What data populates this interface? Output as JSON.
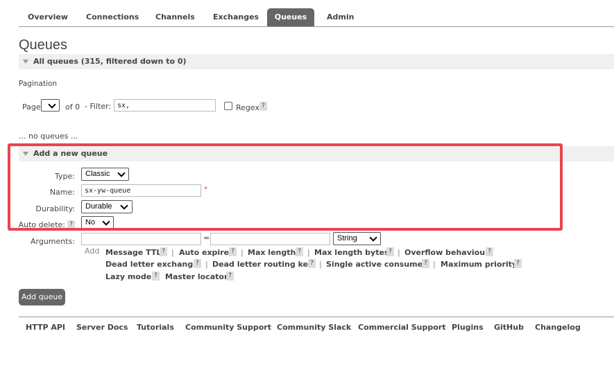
{
  "tabs": [
    {
      "label": "Overview",
      "active": false
    },
    {
      "label": "Connections",
      "active": false
    },
    {
      "label": "Channels",
      "active": false
    },
    {
      "label": "Exchanges",
      "active": false
    },
    {
      "label": "Queues",
      "active": true
    },
    {
      "label": "Admin",
      "active": false
    }
  ],
  "page_title": "Queues",
  "all_queues": {
    "label": "All queues (315, filtered down to 0)"
  },
  "pagination": {
    "label": "Pagination",
    "page_label": "Page",
    "page_value": "",
    "of_label": "of 0",
    "filter_label": "- Filter:",
    "filter_value": "sx,",
    "regex_label": "Regex",
    "help": "?"
  },
  "no_queues_text": "... no queues ...",
  "add_queue": {
    "section_label": "Add a new queue",
    "type_label": "Type:",
    "type_value": "Classic",
    "name_label": "Name:",
    "name_value": "sx-yw-queue",
    "required_mark": "*",
    "durability_label": "Durability:",
    "durability_value": "Durable",
    "auto_delete_label": "Auto delete:",
    "auto_delete_help": "?",
    "auto_delete_value": "No",
    "arguments_label": "Arguments:",
    "arg_equals": "=",
    "arg_type_value": "String",
    "add_label": "Add",
    "arg_links": [
      "Message TTL",
      "Auto expire",
      "Max length",
      "Max length bytes",
      "Overflow behaviour",
      "Dead letter exchange",
      "Dead letter routing key",
      "Single active consumer",
      "Maximum priority",
      "Lazy mode",
      "Master locator"
    ],
    "help": "?",
    "separator": "|",
    "button_label": "Add queue"
  },
  "footer": {
    "links": [
      "HTTP API",
      "Server Docs",
      "Tutorials",
      "Community Support",
      "Community Slack",
      "Commercial Support",
      "Plugins",
      "GitHub",
      "Changelog"
    ]
  },
  "colors": {
    "active_tab": "#666666",
    "highlight": "#e8454f",
    "required": "#ee3333",
    "section_bg": "#f0f0f0"
  }
}
